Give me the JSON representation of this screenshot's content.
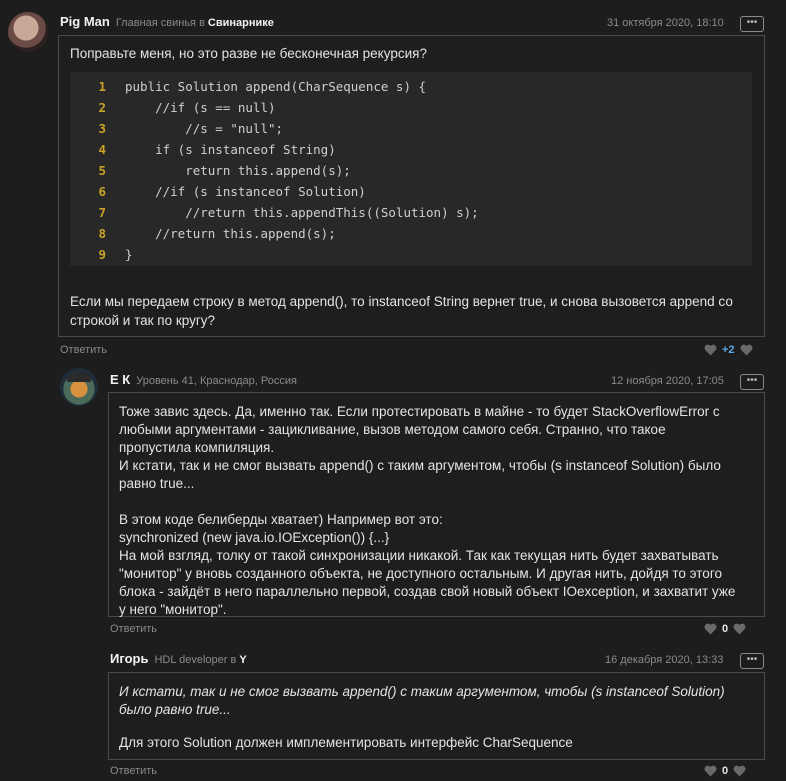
{
  "comments": [
    {
      "author": "Pig Man",
      "meta_prefix": "Главная свинья в",
      "meta_link": "Свинарнике",
      "date": "31 октября 2020, 18:10",
      "text_intro": "Поправьте меня, но это разве не бесконечная рекурсия?",
      "code_lines": [
        "public Solution append(CharSequence s) {",
        "    //if (s == null)",
        "        //s = \"null\";",
        "    if (s instanceof String)",
        "        return this.append(s);",
        "    //if (s instanceof Solution)",
        "        //return this.appendThis((Solution) s);",
        "    //return this.append(s);",
        "}"
      ],
      "line_numbers": [
        "1",
        "2",
        "3",
        "4",
        "5",
        "6",
        "7",
        "8",
        "9"
      ],
      "text_outro_1": "Если мы передаем строку в метод append(), то instanceof String вернет true, и снова вызовется append со",
      "text_outro_2": "строкой и так по кругу?",
      "reply_label": "Ответить",
      "score": "+2",
      "score_color": "#5aa9e6"
    },
    {
      "author": "Е К",
      "meta_prefix": "Уровень 41, Краснодар, Россия",
      "date": "12 ноября 2020, 17:05",
      "lines": [
        "Тоже завис здесь. Да, именно так. Если протестировать в майне - то будет StackOverflowError с",
        "любыми аргументами - зацикливание, вызов методом самого себя. Странно, что такое",
        "пропустила компиляция.",
        "И кстати, так и не смог вызвать append() с таким аргументом, чтобы (s instanceof Solution) было",
        "равно true...",
        "",
        "В этом коде белиберды хватает) Например вот это:",
        "synchronized (new java.io.IOException()) {...}",
        "На мой взгляд, толку от такой синхронизации никакой. Так как текущая нить будет захватывать",
        "\"монитор\" у вновь созданного объекта, не доступного остальным. И другая нить, дойдя то этого",
        "блока - зайдёт в него параллельно первой, создав свой новый объект IOexception, и захватит уже",
        "у него \"монитор\"."
      ],
      "reply_label": "Ответить",
      "score": "0"
    },
    {
      "author": "Игорь",
      "meta_prefix": "HDL developer в",
      "meta_link": "Y",
      "date": "16 декабря 2020, 13:33",
      "quote_1": "И кстати, так и не смог вызвать append() с таким аргументом, чтобы (s instanceof Solution)",
      "quote_2": "было равно true...",
      "answer": "Для этого Solution должен имплементировать интерфейс CharSequence",
      "reply_label": "Ответить",
      "score": "0"
    }
  ],
  "more_label": "•••"
}
